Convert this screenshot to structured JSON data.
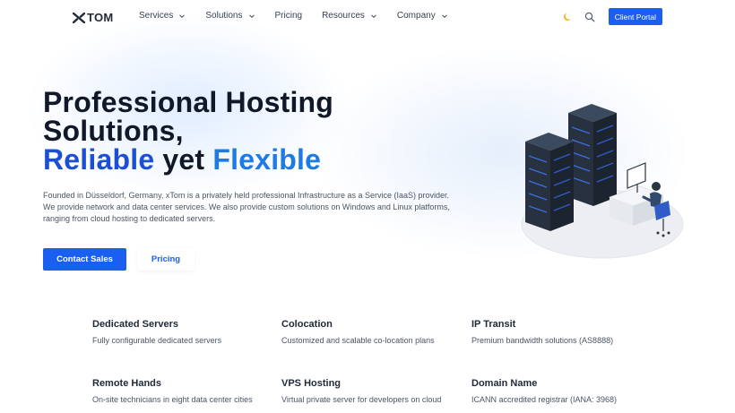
{
  "brand": {
    "name": "TOM",
    "accent": "#1a5ff0"
  },
  "nav": {
    "items": [
      {
        "label": "Services",
        "has_dropdown": true
      },
      {
        "label": "Solutions",
        "has_dropdown": true
      },
      {
        "label": "Pricing",
        "has_dropdown": false
      },
      {
        "label": "Resources",
        "has_dropdown": true
      },
      {
        "label": "Company",
        "has_dropdown": true
      }
    ],
    "icons": [
      "moon-icon",
      "search-icon"
    ],
    "client_portal": "Client Portal"
  },
  "hero": {
    "title_line1": "Professional Hosting",
    "title_line2": "Solutions,",
    "title_word_a": "Reliable",
    "title_mid": " yet ",
    "title_word_b": "Flexible",
    "description": "Founded in Düsseldorf, Germany, xTom is a privately held professional Infrastructure as a Service (IaaS) provider. We provide network and data center services. We also provide custom solutions on Windows and Linux platforms, ranging from cloud hosting to dedicated servers.",
    "primary_cta": "Contact Sales",
    "secondary_cta": "Pricing"
  },
  "services": [
    {
      "title": "Dedicated Servers",
      "desc": "Fully configurable dedicated servers"
    },
    {
      "title": "Colocation",
      "desc": "Customized and scalable co-location plans"
    },
    {
      "title": "IP Transit",
      "desc": "Premium bandwidth solutions (AS8888)"
    },
    {
      "title": "Remote Hands",
      "desc": "On-site technicians in eight data center cities"
    },
    {
      "title": "VPS Hosting",
      "desc": "Virtual private server for developers on cloud"
    },
    {
      "title": "Domain Name",
      "desc": "ICANN accredited registrar (IANA: 3968)"
    }
  ]
}
